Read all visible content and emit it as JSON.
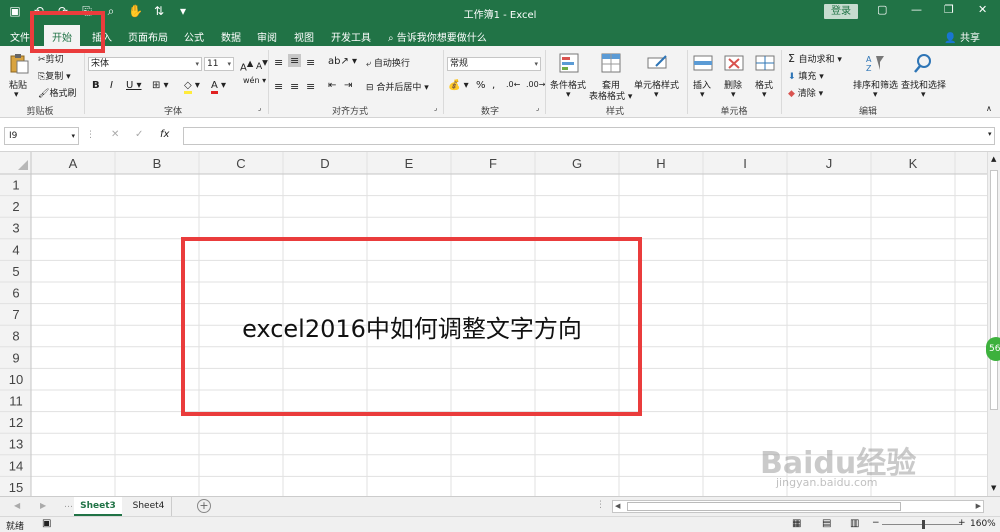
{
  "titlebar": {
    "title": "工作簿1  -  Excel",
    "login": "登录"
  },
  "tabs": [
    {
      "label": "文件"
    },
    {
      "label": "开始"
    },
    {
      "label": "插入"
    },
    {
      "label": "页面布局"
    },
    {
      "label": "公式"
    },
    {
      "label": "数据"
    },
    {
      "label": "审阅"
    },
    {
      "label": "视图"
    },
    {
      "label": "开发工具"
    }
  ],
  "tell_me": "告诉我你想要做什么",
  "share": "共享",
  "ribbon": {
    "clipboard": {
      "paste": "粘贴",
      "cut": "剪切",
      "copy": "复制",
      "format_painter": "格式刷",
      "label": "剪贴板"
    },
    "font": {
      "font_name": "宋体",
      "font_size": "11",
      "label": "字体"
    },
    "alignment": {
      "wrap": "自动换行",
      "merge": "合并后居中",
      "label": "对齐方式"
    },
    "number": {
      "format": "常规",
      "label": "数字"
    },
    "styles": {
      "conditional": "条件格式",
      "table": "套用\n表格格式",
      "cell_styles": "单元格样式",
      "label": "样式"
    },
    "cells": {
      "insert": "插入",
      "delete": "删除",
      "format": "格式",
      "label": "单元格"
    },
    "editing": {
      "autosum": "自动求和",
      "fill": "填充",
      "clear": "清除",
      "sort": "排序和筛选",
      "find": "查找和选择",
      "label": "编辑"
    }
  },
  "formula_bar": {
    "name_box": "I9",
    "fx": "fx"
  },
  "columns": [
    "A",
    "B",
    "C",
    "D",
    "E",
    "F",
    "G",
    "H",
    "I",
    "J",
    "K"
  ],
  "rows": [
    "1",
    "2",
    "3",
    "4",
    "5",
    "6",
    "7",
    "8",
    "9",
    "10",
    "11",
    "12",
    "13",
    "14",
    "15"
  ],
  "overlay_text": "excel2016中如何调整文字方向",
  "sheets": [
    {
      "name": "Sheet3"
    },
    {
      "name": "Sheet4"
    }
  ],
  "status": {
    "ready": "就绪",
    "zoom": "160%"
  },
  "watermark": {
    "main": "Baidu经验",
    "sub": "jingyan.baidu.com"
  },
  "side_badge": "56",
  "colors": {
    "accent": "#217346",
    "highlight": "#ea3c3c"
  }
}
